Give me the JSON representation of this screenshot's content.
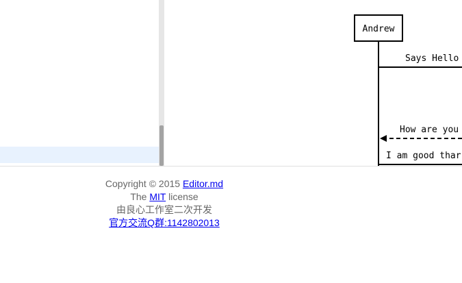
{
  "diagram": {
    "participant": "Andrew",
    "messages": [
      {
        "text": "Says Hello",
        "type": "solid",
        "direction": "right"
      },
      {
        "text": "How are you",
        "type": "dashed",
        "direction": "left"
      },
      {
        "text": "I am good thar",
        "type": "solid",
        "direction": "right"
      }
    ]
  },
  "footer": {
    "copyright_prefix": "Copyright © 2015 ",
    "editor_link": "Editor.md",
    "license_prefix": "The ",
    "license_link": "MIT",
    "license_suffix": " license",
    "secondary_dev": "由良心工作室二次开发",
    "qq_group_link": "官方交流Q群:1142802013"
  }
}
